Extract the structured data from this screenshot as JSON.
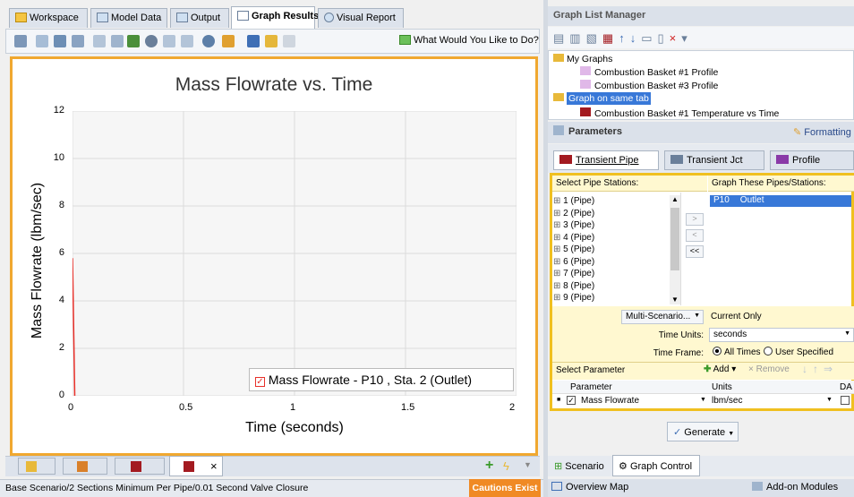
{
  "tabs": [
    {
      "label": "Workspace"
    },
    {
      "label": "Model Data"
    },
    {
      "label": "Output"
    },
    {
      "label": "Graph Results"
    },
    {
      "label": "Visual Report"
    }
  ],
  "toolbar": {
    "help_label": "What Would You Like to Do?"
  },
  "chart_data": {
    "type": "line",
    "title": "Mass Flowrate vs. Time",
    "xlabel": "Time (seconds)",
    "ylabel": "Mass Flowrate (lbm/sec)",
    "xlim": [
      0,
      2
    ],
    "ylim": [
      0,
      12
    ],
    "xticks": [
      "0",
      "0.5",
      "1",
      "1.5",
      "2"
    ],
    "yticks": [
      "0",
      "2",
      "4",
      "6",
      "8",
      "10",
      "12"
    ],
    "grid": true,
    "legend": "bottom-right",
    "series": [
      {
        "name": "Mass Flowrate - P10 , Sta. 2 (Outlet)",
        "color": "#e8302a",
        "x": [
          0,
          0.01
        ],
        "y": [
          5.8,
          0
        ]
      }
    ]
  },
  "bottom_tabs": {
    "close": "×"
  },
  "status": {
    "scenario": "Base Scenario/2 Sections Minimum Per Pipe/0.01 Second Valve Closure",
    "cautions": "Cautions Exist"
  },
  "graph_list": {
    "title": "Graph List Manager",
    "items": [
      "My Graphs",
      "Combustion Basket #1 Profile",
      "Combustion Basket #3 Profile",
      "Graph on same tab",
      "Combustion Basket #1 Temperature vs Time"
    ]
  },
  "params": {
    "title": "Parameters",
    "formatting": "Formatting",
    "tabs": [
      "Transient Pipe",
      "Transient Jct",
      "Profile"
    ],
    "select_stations": "Select Pipe Stations:",
    "graph_these": "Graph These Pipes/Stations:",
    "pipes": [
      "1 (Pipe)",
      "2 (Pipe)",
      "3 (Pipe)",
      "4 (Pipe)",
      "5 (Pipe)",
      "6 (Pipe)",
      "7 (Pipe)",
      "8 (Pipe)",
      "9 (Pipe)"
    ],
    "selected_pipe": "P10",
    "selected_station": "Outlet",
    "btn_add": ">",
    "btn_remove": "<",
    "btn_clear": "<<",
    "multi_scenario": "Multi-Scenario...",
    "current_only": "Current Only",
    "time_units_label": "Time Units:",
    "time_units": "seconds",
    "time_frame_label": "Time Frame:",
    "all_times": "All Times",
    "user_specified": "User Specified",
    "select_parameter": "Select Parameter",
    "add": "Add",
    "remove": "Remove",
    "col_parameter": "Parameter",
    "col_units": "Units",
    "col_da": "DA",
    "param_name": "Mass Flowrate",
    "param_units": "lbm/sec",
    "generate": "Generate"
  },
  "lower_tabs": [
    "Scenario",
    "Graph Control"
  ],
  "footer": {
    "overview": "Overview Map",
    "addons": "Add-on Modules"
  }
}
